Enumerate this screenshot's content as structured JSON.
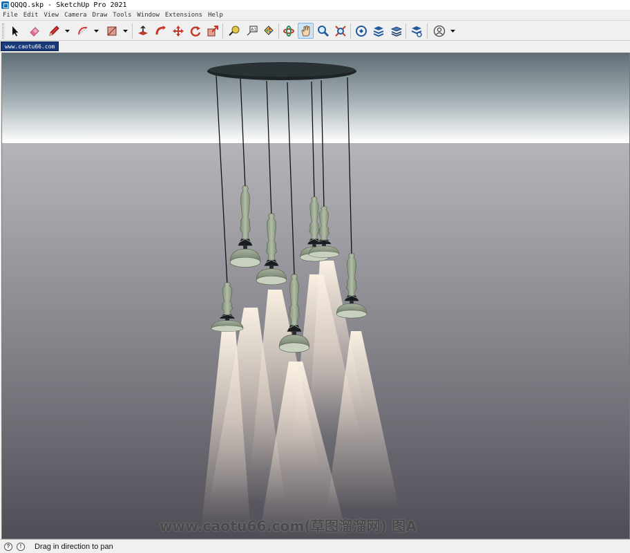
{
  "window": {
    "title": "QQQQ.skp - SketchUp Pro 2021"
  },
  "menu": [
    "File",
    "Edit",
    "View",
    "Camera",
    "Draw",
    "Tools",
    "Window",
    "Extensions",
    "Help"
  ],
  "toolbar": {
    "tools": [
      {
        "name": "select-tool",
        "icon": "arrow-cursor-icon",
        "active": false
      },
      {
        "name": "eraser-tool",
        "icon": "eraser-icon",
        "active": false
      },
      {
        "name": "line-tool",
        "icon": "pencil-icon",
        "active": false
      },
      {
        "name": "arc-tool",
        "icon": "arc-icon",
        "active": false
      },
      {
        "name": "shape-tool",
        "icon": "rectangle-icon",
        "active": false
      },
      {
        "name": "push-pull-tool",
        "icon": "push-pull-icon",
        "active": false
      },
      {
        "name": "follow-me-tool",
        "icon": "follow-me-icon",
        "active": false
      },
      {
        "name": "move-tool",
        "icon": "move-icon",
        "active": false
      },
      {
        "name": "rotate-tool",
        "icon": "rotate-icon",
        "active": false
      },
      {
        "name": "scale-tool",
        "icon": "scale-icon",
        "active": false
      },
      {
        "name": "tape-measure-tool",
        "icon": "tape-measure-icon",
        "active": false
      },
      {
        "name": "text-tool",
        "icon": "text-label-icon",
        "active": false
      },
      {
        "name": "paint-bucket-tool",
        "icon": "paint-bucket-icon",
        "active": false
      },
      {
        "name": "orbit-tool",
        "icon": "orbit-icon",
        "active": false
      },
      {
        "name": "pan-tool",
        "icon": "hand-icon",
        "active": true
      },
      {
        "name": "zoom-tool",
        "icon": "magnifier-icon",
        "active": false
      },
      {
        "name": "zoom-extents-tool",
        "icon": "zoom-extents-icon",
        "active": false
      },
      {
        "name": "3d-warehouse-button",
        "icon": "warehouse-icon",
        "active": false
      },
      {
        "name": "extension-warehouse-button",
        "icon": "extension-warehouse-icon",
        "active": false
      },
      {
        "name": "layout-button",
        "icon": "layers-stack-icon",
        "active": false
      },
      {
        "name": "extension-manager-button",
        "icon": "extension-manager-icon",
        "active": false
      },
      {
        "name": "account-button",
        "icon": "user-avatar-icon",
        "active": false
      }
    ]
  },
  "scene_tab": {
    "label": "www.caotu66.com"
  },
  "watermark": {
    "text": "www.caotu66.com(草图溜溜网) 图A"
  },
  "status": {
    "text": "Drag in direction to pan"
  },
  "colors": {
    "sky_top": "#5e6c74",
    "sky_horizon": "#ffffff",
    "ground_top": "#b5b5b9",
    "ground_bottom": "#4f4c55",
    "shade": "#8a9880",
    "cord": "#111111",
    "canopy": "#1e2326",
    "tab": "#1a3a7a",
    "active_tool": "#cde4f7"
  }
}
